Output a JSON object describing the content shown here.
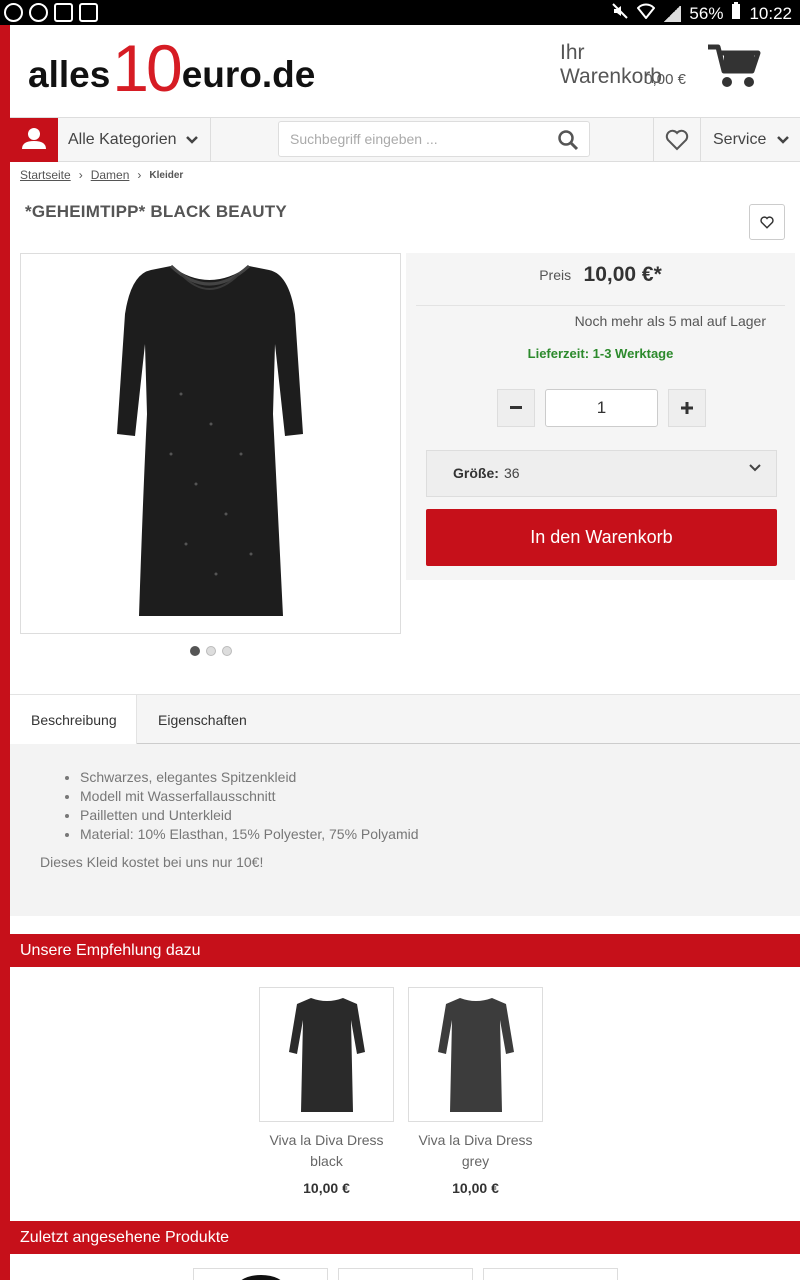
{
  "statusbar": {
    "battery": "56%",
    "time": "10:22"
  },
  "header": {
    "logo": {
      "part1": "alles",
      "part2": "10",
      "part3": "euro.de"
    },
    "cart_label": "Ihr Warenkorb",
    "cart_amount": "0,00 €"
  },
  "nav": {
    "categories_label": "Alle Kategorien",
    "search_placeholder": "Suchbegriff eingeben ...",
    "service_label": "Service"
  },
  "breadcrumb": {
    "home": "Startseite",
    "women": "Damen",
    "current": "Kleider"
  },
  "product": {
    "title": "*GEHEIMTIPP* BLACK BEAUTY",
    "price_label": "Preis",
    "price": "10,00 €*",
    "stock": "Noch mehr als 5 mal auf Lager",
    "delivery": "Lieferzeit: 1-3 Werktage",
    "quantity": "1",
    "size_label": "Größe:",
    "size_value": "36",
    "add_to_cart": "In den Warenkorb",
    "image_count": 3,
    "active_image": 1
  },
  "tabs": {
    "description": "Beschreibung",
    "properties": "Eigenschaften"
  },
  "description": {
    "bullets": [
      "Schwarzes, elegantes Spitzenkleid",
      "Modell mit Wasserfallausschnitt",
      "Pailletten und Unterkleid",
      "Material: 10% Elasthan, 15% Polyester, 75% Polyamid"
    ],
    "text": "Dieses Kleid kostet bei uns nur 10€!"
  },
  "recommendations": {
    "title": "Unsere Empfehlung dazu",
    "items": [
      {
        "name_line1": "Viva la Diva Dress",
        "name_line2": "black",
        "price": "10,00 €"
      },
      {
        "name_line1": "Viva la Diva Dress",
        "name_line2": "grey",
        "price": "10,00 €"
      }
    ]
  },
  "recently_viewed": {
    "title": "Zuletzt angesehene Produkte"
  },
  "colors": {
    "brand_red": "#c6101a",
    "delivery_green": "#2c8a2c"
  }
}
